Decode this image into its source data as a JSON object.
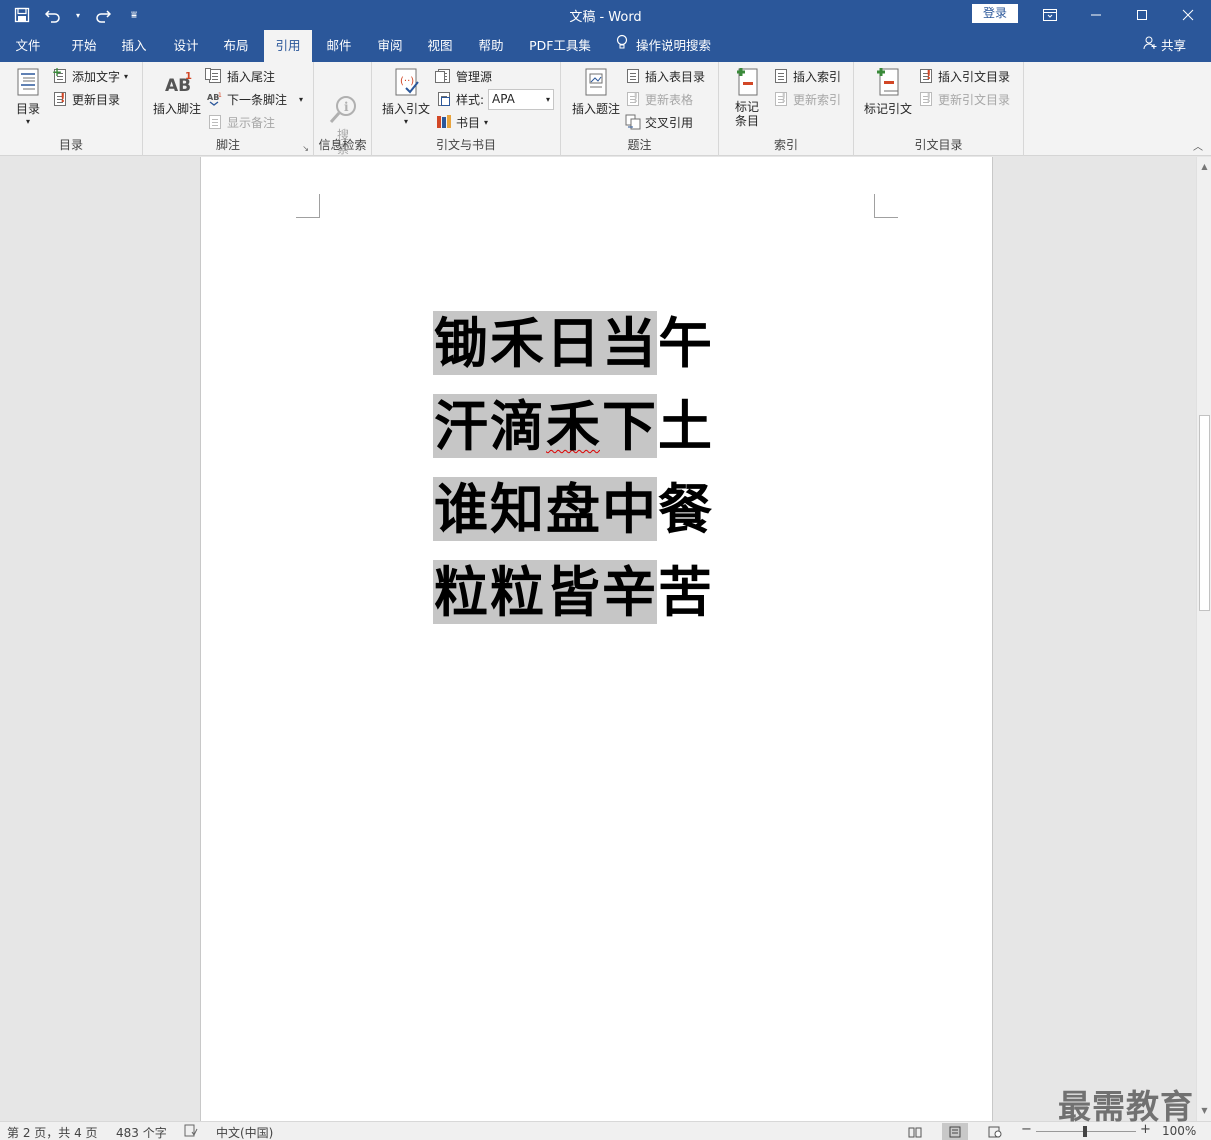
{
  "titlebar": {
    "title": "文稿  -  Word",
    "login": "登录",
    "qat_customize": "⩸"
  },
  "tabs": [
    {
      "label": "文件"
    },
    {
      "label": "开始"
    },
    {
      "label": "插入"
    },
    {
      "label": "设计"
    },
    {
      "label": "布局"
    },
    {
      "label": "引用",
      "active": true
    },
    {
      "label": "邮件"
    },
    {
      "label": "审阅"
    },
    {
      "label": "视图"
    },
    {
      "label": "帮助"
    },
    {
      "label": "PDF工具集"
    }
  ],
  "tell_me": "操作说明搜索",
  "share": "共享",
  "ribbon": {
    "toc": {
      "group_label": "目录",
      "toc_button": "目录",
      "add_text": "添加文字",
      "update_toc": "更新目录"
    },
    "footnotes": {
      "group_label": "脚注",
      "insert_footnote": "插入脚注",
      "insert_endnote": "插入尾注",
      "next_footnote": "下一条脚注",
      "show_notes": "显示备注"
    },
    "research": {
      "group_label": "信息检索",
      "search": "搜\n索"
    },
    "citations": {
      "group_label": "引文与书目",
      "insert_citation": "插入引文",
      "manage_sources": "管理源",
      "style_label": "样式:",
      "style_value": "APA",
      "bibliography": "书目"
    },
    "captions": {
      "group_label": "题注",
      "insert_caption": "插入题注",
      "insert_table_of_figures": "插入表目录",
      "update_table": "更新表格",
      "cross_reference": "交叉引用"
    },
    "index": {
      "group_label": "索引",
      "mark_entry_line1": "标记",
      "mark_entry_line2": "条目",
      "insert_index": "插入索引",
      "update_index": "更新索引"
    },
    "table_of_authorities": {
      "group_label": "引文目录",
      "mark_citation": "标记引文",
      "insert_toa": "插入引文目录",
      "update_toa": "更新引文目录"
    }
  },
  "document": {
    "lines": [
      [
        "锄",
        "禾",
        "日",
        "当",
        "午"
      ],
      [
        "汗",
        "滴",
        "禾",
        "下",
        "土"
      ],
      [
        "谁",
        "知",
        "盘",
        "中",
        "餐"
      ],
      [
        "粒",
        "粒",
        "皆",
        "辛",
        "苦"
      ]
    ]
  },
  "statusbar": {
    "page": "第 2 页，共 4 页",
    "words": "483 个字",
    "language": "中文(中国)",
    "zoom_minus": "−",
    "zoom_plus": "+",
    "zoom": "100%"
  },
  "watermark": "最需教育"
}
